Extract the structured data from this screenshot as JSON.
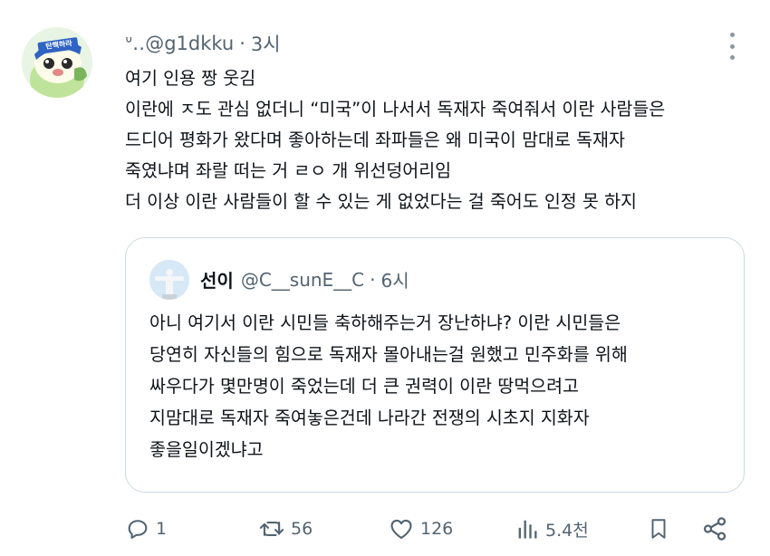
{
  "tweet": {
    "handle": "ᐡ‥@g1dkku",
    "separator": "·",
    "time": "3시",
    "avatar_badge": "탄핵하라",
    "lines": [
      "여기 인용 짱 웃김",
      "이란에 ㅈ도 관심 없더니 “미국”이 나서서 독재자 죽여줘서 이란 사람들은",
      "드디어 평화가 왔다며 좋아하는데 좌파들은 왜 미국이 맘대로 독재자",
      "죽였냐며 좌랄 떠는 거 ㄹㅇ 개 위선덩어리임",
      "더 이상 이란 사람들이 할 수 있는 게 없었다는 걸 죽어도 인정 못 하지"
    ]
  },
  "quote": {
    "name": "선이",
    "handle": "@C__sunE__C",
    "separator": "·",
    "time": "6시",
    "lines": [
      "아니 여기서 이란 시민들 축하해주는거 장난하냐? 이란 시민들은",
      "당연히 자신들의 힘으로 독재자 몰아내는걸 원했고 민주화를 위해",
      "싸우다가 몇만명이 죽었는데 더 큰 권력이 이란 땅먹으려고",
      "지맘대로 독재자 죽여놓은건데 나라간 전쟁의 시초지 지화자",
      "좋을일이겠냐고"
    ]
  },
  "actions": {
    "replies": "1",
    "retweets": "56",
    "likes": "126",
    "views": "5.4천"
  },
  "colors": {
    "text": "#0f1419",
    "secondary": "#536471",
    "border": "#cfd9de"
  }
}
